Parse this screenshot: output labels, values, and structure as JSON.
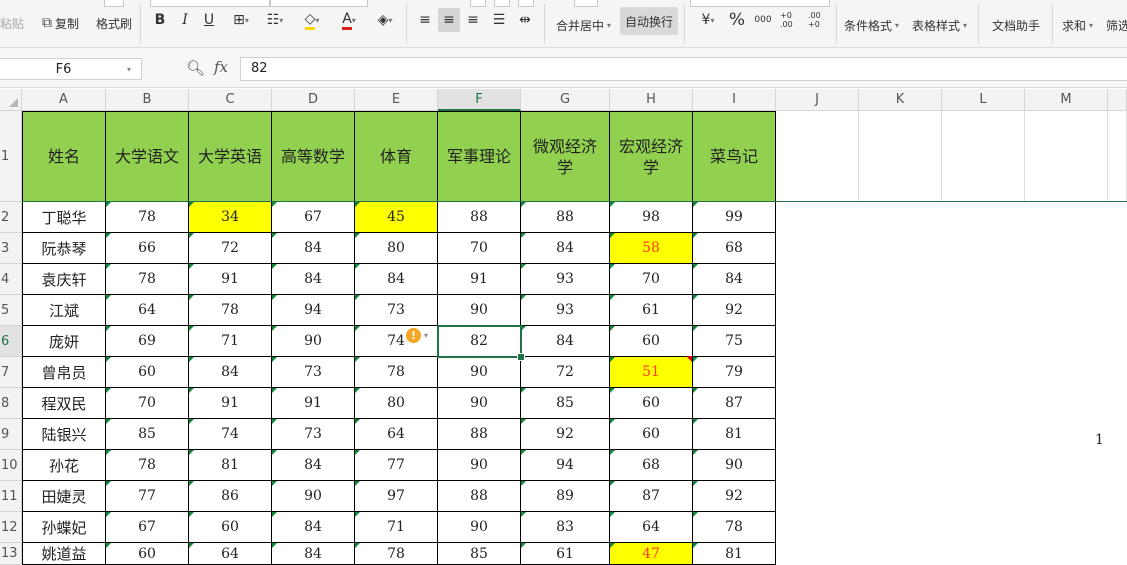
{
  "ribbon": {
    "paste": "粘贴",
    "copy": "复制",
    "format_painter": "格式刷",
    "bold": "B",
    "italic": "I",
    "underline": "U",
    "merge_center": "合并居中",
    "wrap_text": "自动换行",
    "percent": "%",
    "thousands": "000",
    "dec_inc": "+0 .00",
    "dec_dec": ".00 +0",
    "conditional_format": "条件格式",
    "table_style": "表格样式",
    "doc_assistant": "文档助手",
    "sum": "求和",
    "filter": "筛选",
    "font_color_accent": "#e0211a",
    "fill_color_accent": "#ffd400"
  },
  "formula_bar": {
    "name_box": "F6",
    "fx": "fx",
    "value": "82"
  },
  "sheet": {
    "columns": [
      "A",
      "B",
      "C",
      "D",
      "E",
      "F",
      "G",
      "H",
      "I",
      "J",
      "K",
      "L",
      "M"
    ],
    "row_numbers": [
      "1",
      "2",
      "3",
      "4",
      "5",
      "6",
      "7",
      "8",
      "9",
      "10",
      "11",
      "12",
      "13"
    ],
    "selected_column": "F",
    "selected_row": "6",
    "header_fill": "#92d050",
    "highlight_fill": "#ffff00",
    "headers": [
      "姓名",
      "大学语文",
      "大学英语",
      "高等数学",
      "体育",
      "军事理论",
      "微观经济学",
      "宏观经济学",
      "菜鸟记"
    ],
    "rows": [
      [
        "丁聪华",
        "78",
        "34",
        "67",
        "45",
        "88",
        "88",
        "98",
        "99"
      ],
      [
        "阮恭琴",
        "66",
        "72",
        "84",
        "80",
        "70",
        "84",
        "58",
        "68"
      ],
      [
        "袁庆轩",
        "78",
        "91",
        "84",
        "84",
        "91",
        "93",
        "70",
        "84"
      ],
      [
        "江斌",
        "64",
        "78",
        "94",
        "73",
        "90",
        "93",
        "61",
        "92"
      ],
      [
        "庞妍",
        "69",
        "71",
        "90",
        "74",
        "82",
        "84",
        "60",
        "75"
      ],
      [
        "曾帛员",
        "60",
        "84",
        "73",
        "78",
        "90",
        "72",
        "51",
        "79"
      ],
      [
        "程双民",
        "70",
        "91",
        "91",
        "80",
        "90",
        "85",
        "60",
        "87"
      ],
      [
        "陆银兴",
        "85",
        "74",
        "73",
        "64",
        "88",
        "92",
        "60",
        "81"
      ],
      [
        "孙花",
        "78",
        "81",
        "84",
        "77",
        "90",
        "94",
        "68",
        "90"
      ],
      [
        "田婕灵",
        "77",
        "86",
        "90",
        "97",
        "88",
        "89",
        "87",
        "92"
      ],
      [
        "孙蝶妃",
        "67",
        "60",
        "84",
        "71",
        "90",
        "83",
        "64",
        "78"
      ],
      [
        "姚道益",
        "60",
        "64",
        "84",
        "78",
        "85",
        "61",
        "47",
        "81"
      ]
    ],
    "stray_value": "1"
  }
}
